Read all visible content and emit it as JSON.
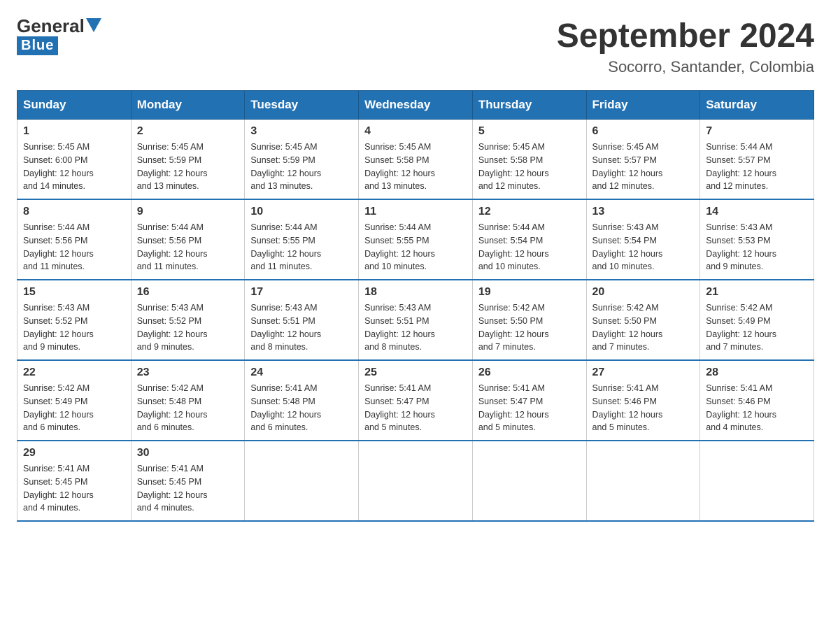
{
  "logo": {
    "general": "General",
    "blue": "Blue"
  },
  "title": "September 2024",
  "subtitle": "Socorro, Santander, Colombia",
  "days_header": [
    "Sunday",
    "Monday",
    "Tuesday",
    "Wednesday",
    "Thursday",
    "Friday",
    "Saturday"
  ],
  "weeks": [
    [
      {
        "day": "1",
        "info": "Sunrise: 5:45 AM\nSunset: 6:00 PM\nDaylight: 12 hours\nand 14 minutes."
      },
      {
        "day": "2",
        "info": "Sunrise: 5:45 AM\nSunset: 5:59 PM\nDaylight: 12 hours\nand 13 minutes."
      },
      {
        "day": "3",
        "info": "Sunrise: 5:45 AM\nSunset: 5:59 PM\nDaylight: 12 hours\nand 13 minutes."
      },
      {
        "day": "4",
        "info": "Sunrise: 5:45 AM\nSunset: 5:58 PM\nDaylight: 12 hours\nand 13 minutes."
      },
      {
        "day": "5",
        "info": "Sunrise: 5:45 AM\nSunset: 5:58 PM\nDaylight: 12 hours\nand 12 minutes."
      },
      {
        "day": "6",
        "info": "Sunrise: 5:45 AM\nSunset: 5:57 PM\nDaylight: 12 hours\nand 12 minutes."
      },
      {
        "day": "7",
        "info": "Sunrise: 5:44 AM\nSunset: 5:57 PM\nDaylight: 12 hours\nand 12 minutes."
      }
    ],
    [
      {
        "day": "8",
        "info": "Sunrise: 5:44 AM\nSunset: 5:56 PM\nDaylight: 12 hours\nand 11 minutes."
      },
      {
        "day": "9",
        "info": "Sunrise: 5:44 AM\nSunset: 5:56 PM\nDaylight: 12 hours\nand 11 minutes."
      },
      {
        "day": "10",
        "info": "Sunrise: 5:44 AM\nSunset: 5:55 PM\nDaylight: 12 hours\nand 11 minutes."
      },
      {
        "day": "11",
        "info": "Sunrise: 5:44 AM\nSunset: 5:55 PM\nDaylight: 12 hours\nand 10 minutes."
      },
      {
        "day": "12",
        "info": "Sunrise: 5:44 AM\nSunset: 5:54 PM\nDaylight: 12 hours\nand 10 minutes."
      },
      {
        "day": "13",
        "info": "Sunrise: 5:43 AM\nSunset: 5:54 PM\nDaylight: 12 hours\nand 10 minutes."
      },
      {
        "day": "14",
        "info": "Sunrise: 5:43 AM\nSunset: 5:53 PM\nDaylight: 12 hours\nand 9 minutes."
      }
    ],
    [
      {
        "day": "15",
        "info": "Sunrise: 5:43 AM\nSunset: 5:52 PM\nDaylight: 12 hours\nand 9 minutes."
      },
      {
        "day": "16",
        "info": "Sunrise: 5:43 AM\nSunset: 5:52 PM\nDaylight: 12 hours\nand 9 minutes."
      },
      {
        "day": "17",
        "info": "Sunrise: 5:43 AM\nSunset: 5:51 PM\nDaylight: 12 hours\nand 8 minutes."
      },
      {
        "day": "18",
        "info": "Sunrise: 5:43 AM\nSunset: 5:51 PM\nDaylight: 12 hours\nand 8 minutes."
      },
      {
        "day": "19",
        "info": "Sunrise: 5:42 AM\nSunset: 5:50 PM\nDaylight: 12 hours\nand 7 minutes."
      },
      {
        "day": "20",
        "info": "Sunrise: 5:42 AM\nSunset: 5:50 PM\nDaylight: 12 hours\nand 7 minutes."
      },
      {
        "day": "21",
        "info": "Sunrise: 5:42 AM\nSunset: 5:49 PM\nDaylight: 12 hours\nand 7 minutes."
      }
    ],
    [
      {
        "day": "22",
        "info": "Sunrise: 5:42 AM\nSunset: 5:49 PM\nDaylight: 12 hours\nand 6 minutes."
      },
      {
        "day": "23",
        "info": "Sunrise: 5:42 AM\nSunset: 5:48 PM\nDaylight: 12 hours\nand 6 minutes."
      },
      {
        "day": "24",
        "info": "Sunrise: 5:41 AM\nSunset: 5:48 PM\nDaylight: 12 hours\nand 6 minutes."
      },
      {
        "day": "25",
        "info": "Sunrise: 5:41 AM\nSunset: 5:47 PM\nDaylight: 12 hours\nand 5 minutes."
      },
      {
        "day": "26",
        "info": "Sunrise: 5:41 AM\nSunset: 5:47 PM\nDaylight: 12 hours\nand 5 minutes."
      },
      {
        "day": "27",
        "info": "Sunrise: 5:41 AM\nSunset: 5:46 PM\nDaylight: 12 hours\nand 5 minutes."
      },
      {
        "day": "28",
        "info": "Sunrise: 5:41 AM\nSunset: 5:46 PM\nDaylight: 12 hours\nand 4 minutes."
      }
    ],
    [
      {
        "day": "29",
        "info": "Sunrise: 5:41 AM\nSunset: 5:45 PM\nDaylight: 12 hours\nand 4 minutes."
      },
      {
        "day": "30",
        "info": "Sunrise: 5:41 AM\nSunset: 5:45 PM\nDaylight: 12 hours\nand 4 minutes."
      },
      {
        "day": "",
        "info": ""
      },
      {
        "day": "",
        "info": ""
      },
      {
        "day": "",
        "info": ""
      },
      {
        "day": "",
        "info": ""
      },
      {
        "day": "",
        "info": ""
      }
    ]
  ]
}
